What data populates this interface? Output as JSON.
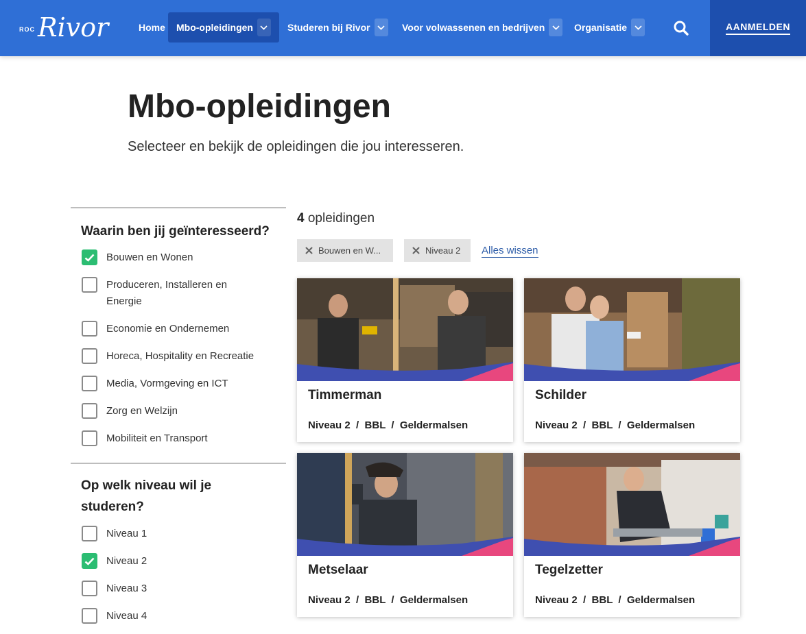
{
  "nav": {
    "logo_roc": "ROC",
    "logo_name": "Rivor",
    "items": [
      {
        "label": "Home"
      },
      {
        "label": "Mbo-opleidingen"
      },
      {
        "label": "Studeren bij Rivor"
      },
      {
        "label": "Voor volwassenen en bedrijven"
      },
      {
        "label": "Organisatie"
      }
    ],
    "search_icon": "search-icon",
    "login_label": "AANMELDEN"
  },
  "header": {
    "title": "Mbo-opleidingen",
    "subtitle": "Selecteer en bekijk de opleidingen die jou interesseren."
  },
  "filters": {
    "interest": {
      "title": "Waarin ben jij geïnteresseerd?",
      "options": [
        {
          "label": "Bouwen en Wonen",
          "checked": true
        },
        {
          "label": "Produceren, Installeren en Energie",
          "checked": false
        },
        {
          "label": "Economie en Ondernemen",
          "checked": false
        },
        {
          "label": "Horeca, Hospitality en Recreatie",
          "checked": false
        },
        {
          "label": "Media, Vormgeving en ICT",
          "checked": false
        },
        {
          "label": "Zorg en Welzijn",
          "checked": false
        },
        {
          "label": "Mobiliteit en Transport",
          "checked": false
        }
      ]
    },
    "level": {
      "title": "Op welk niveau wil je studeren?",
      "options": [
        {
          "label": "Niveau 1",
          "checked": false
        },
        {
          "label": "Niveau 2",
          "checked": true
        },
        {
          "label": "Niveau 3",
          "checked": false
        },
        {
          "label": "Niveau 4",
          "checked": false
        }
      ]
    }
  },
  "results": {
    "count": "4",
    "count_label": "opleidingen",
    "chips": [
      {
        "label": "Bouwen en W..."
      },
      {
        "label": "Niveau 2"
      }
    ],
    "clear_all": "Alles wissen",
    "cards": [
      {
        "title": "Timmerman",
        "meta": "Niveau 2  /  BBL  /  Geldermalsen"
      },
      {
        "title": "Schilder",
        "meta": "Niveau 2  /  BBL  /  Geldermalsen"
      },
      {
        "title": "Metselaar",
        "meta": "Niveau 2  /  BBL  /  Geldermalsen"
      },
      {
        "title": "Tegelzetter",
        "meta": "Niveau 2  /  BBL  /  Geldermalsen"
      }
    ]
  },
  "colors": {
    "nav_bg": "#2f6fd6",
    "nav_dark": "#1d4fae",
    "check_green": "#2bbd72",
    "wave_blue": "#3f4fb0",
    "wave_pink": "#e8477e"
  }
}
